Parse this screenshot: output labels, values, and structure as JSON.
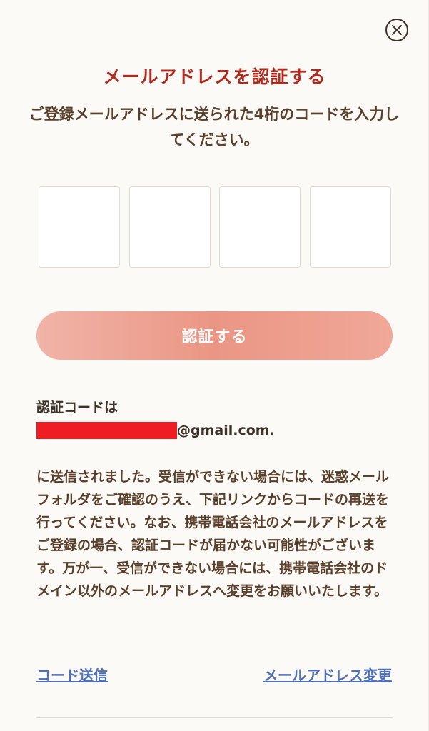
{
  "dialog": {
    "title": "メールアドレスを認証する",
    "subtitle": "ご登録メールアドレスに送られた4桁のコードを入力してください。",
    "close_icon": "close-circle-icon"
  },
  "code_inputs": {
    "count": 4,
    "values": [
      "",
      "",
      "",
      ""
    ]
  },
  "verify_button": {
    "label": "認証する",
    "color": "#eb9684"
  },
  "notice": {
    "sent_label": "認証コードは",
    "email_domain": "@gmail.com.",
    "redaction_color": "#ee1d24",
    "description": "に送信されました。受信ができない場合には、迷惑メールフォルダをご確認のうえ、下記リンクからコードの再送を行ってください。なお、携帯電話会社のメールアドレスをご登録の場合、認証コードが届かない可能性がございます。万が一、受信ができない場合には、携帯電話会社のドメイン以外のメールアドレスへ変更をお願いいたします。"
  },
  "links": {
    "resend": "コード送信",
    "change_email": "メールアドレス変更"
  },
  "colors": {
    "title": "#b02a1e",
    "text": "#5a3f2b",
    "link": "#4f6fb8",
    "background": "#fcfaf7"
  }
}
